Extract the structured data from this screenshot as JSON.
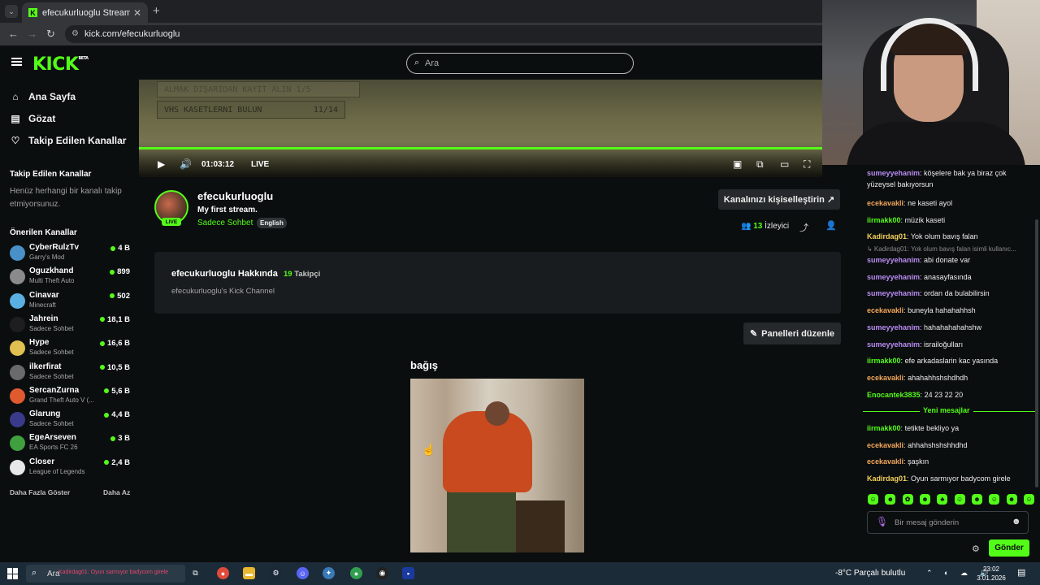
{
  "browser": {
    "tab_title": "efecukurluoglu Stream - Watch",
    "tab_close": "✕",
    "new_tab": "+",
    "url": "kick.com/efecukurluoglu"
  },
  "header": {
    "logo": "KICK",
    "logo_sup": "BETA",
    "search_placeholder": "Ara"
  },
  "sidebar": {
    "nav": [
      {
        "label": "Ana Sayfa",
        "icon": "home-icon"
      },
      {
        "label": "Gözat",
        "icon": "browse-icon"
      },
      {
        "label": "Takip Edilen Kanallar",
        "icon": "heart-icon"
      }
    ],
    "followed_heading": "Takip Edilen Kanallar",
    "no_follow_text": "Henüz herhangi bir kanalı takip etmiyorsunuz.",
    "recommended_heading": "Önerilen Kanallar",
    "channels": [
      {
        "name": "CyberRulzTv",
        "category": "Garry's Mod",
        "viewers": "4 B",
        "color": "#4a90c8"
      },
      {
        "name": "Oguzkhand",
        "category": "Multi Theft Auto",
        "viewers": "899",
        "color": "#8a8a8a"
      },
      {
        "name": "Cinavar",
        "category": "Minecraft",
        "viewers": "502",
        "color": "#5ab0e0"
      },
      {
        "name": "Jahrein",
        "category": "Sadece Sohbet",
        "viewers": "18,1 B",
        "color": "#1e1e1e"
      },
      {
        "name": "Hype",
        "category": "Sadece Sohbet",
        "viewers": "16,6 B",
        "color": "#e0c050"
      },
      {
        "name": "ilkerfirat",
        "category": "Sadece Sohbet",
        "viewers": "10,5 B",
        "color": "#6a6a6a"
      },
      {
        "name": "SercanZurna",
        "category": "Grand Theft Auto V (...",
        "viewers": "5,6 B",
        "color": "#e05a30"
      },
      {
        "name": "Glarung",
        "category": "Sadece Sohbet",
        "viewers": "4,4 B",
        "color": "#3a3a8a"
      },
      {
        "name": "EgeArseven",
        "category": "EA Sports FC 26",
        "viewers": "3 B",
        "color": "#40a040"
      },
      {
        "name": "Closer",
        "category": "League of Legends",
        "viewers": "2,4 B",
        "color": "#e8e8e8"
      }
    ],
    "show_more": "Daha Fazla Göster",
    "show_less": "Daha Az"
  },
  "video": {
    "overlay_line1": "ALMAK DIŞARIDAN KAYIT ALIN   1/5",
    "overlay_line2_left": "VHS KASETLERNI BULUN",
    "overlay_line2_right": "11/14",
    "time": "01:03:12",
    "live": "LIVE"
  },
  "channel": {
    "name": "efecukurluoglu",
    "live_badge": "LIVE",
    "stream_title": "My first stream.",
    "category": "Sadece Sohbet",
    "language": "English",
    "customize_button": "Kanalınızı kişiselleştirin ↗",
    "viewer_count": "13",
    "viewer_label": "İzleyici"
  },
  "about": {
    "title": "efecukurluoglu Hakkında",
    "followers_count": "19",
    "followers_label": "Takipçi",
    "description": "efecukurluoglu's Kick Channel"
  },
  "panels": {
    "edit_button": "Panelleri düzenle",
    "panel_title": "bağış"
  },
  "chat": {
    "messages_top": [
      {
        "user": "sumeyyehanim",
        "color": "#b98cf2",
        "text": "köşelere bak ya biraz çok yüzeysel bakıyorsun"
      },
      {
        "user": "ecekavakli",
        "color": "#f2a65a",
        "text": "ne kaseti ayol"
      },
      {
        "user": "iirmakk00",
        "color": "#53fc18",
        "text": "müzik kaseti"
      },
      {
        "user": "Kadirdag01",
        "color": "#f2d05a",
        "text": "Yok olum bavış falan"
      }
    ],
    "reply_preview": "↳ Kadirdag01: Yok olum bavış falan isimli kullanıc...",
    "messages_mid": [
      {
        "user": "sumeyyehanim",
        "color": "#b98cf2",
        "text": "abi donate var"
      },
      {
        "user": "sumeyyehanim",
        "color": "#b98cf2",
        "text": "anasayfasında"
      },
      {
        "user": "sumeyyehanim",
        "color": "#b98cf2",
        "text": "ordan da bulabilirsin"
      },
      {
        "user": "ecekavakli",
        "color": "#f2a65a",
        "text": "buneyla hahahahhsh"
      },
      {
        "user": "sumeyyehanim",
        "color": "#b98cf2",
        "text": "hahahahahahshw"
      },
      {
        "user": "sumeyyehanim",
        "color": "#b98cf2",
        "text": "israiloğulları"
      },
      {
        "user": "iirmakk00",
        "color": "#53fc18",
        "text": "efe arkadaslarin kac yasında"
      },
      {
        "user": "ecekavakli",
        "color": "#f2a65a",
        "text": "ahahahhshshdhdh"
      },
      {
        "user": "Enocantek3835",
        "color": "#53fc18",
        "text": "24 23 22 20"
      }
    ],
    "new_messages_label": "Yeni mesajlar",
    "messages_new": [
      {
        "user": "iirmakk00",
        "color": "#53fc18",
        "text": "tetikte bekliyo ya"
      },
      {
        "user": "ecekavakli",
        "color": "#f2a65a",
        "text": "ahhahshshshhdhd"
      },
      {
        "user": "ecekavakli",
        "color": "#f2a65a",
        "text": "şaşkın"
      },
      {
        "user": "Kadirdag01",
        "color": "#f2d05a",
        "text": "Oyun sarmıyor badycom girele"
      }
    ],
    "emotes": [
      "☺",
      "☻",
      "✿",
      "☻",
      "♣",
      "☺",
      "☻",
      "☺",
      "☻",
      "☺"
    ],
    "input_placeholder": "Bir mesaj gönderin",
    "send_button": "Gönder"
  },
  "taskbar": {
    "search_label": "Ara",
    "ghost_text": "Kadirdag01: Oyun sarmıyor badycom girele",
    "weather": "-8°C  Parçalı bulutlu",
    "time": "23:02",
    "date": "3.01.2026"
  },
  "colors": {
    "accent": "#53fc18",
    "background": "#0b0e0f",
    "panel": "#181c1e"
  }
}
